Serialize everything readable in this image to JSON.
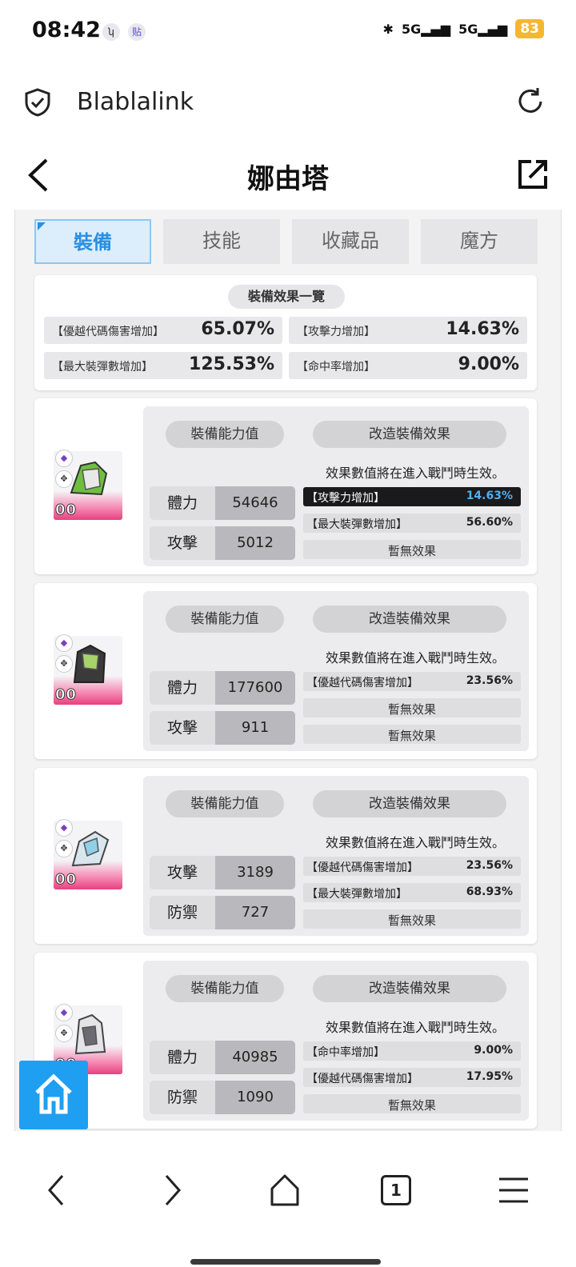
{
  "status": {
    "time": "08:42",
    "app_icon_1": "ʮ",
    "app_icon_2": "贴",
    "net1": "5G",
    "net2": "5G",
    "battery": "83"
  },
  "browser": {
    "site_name": "Blablalink"
  },
  "header": {
    "title": "娜由塔"
  },
  "tabs": [
    {
      "label": "裝備",
      "active": true
    },
    {
      "label": "技能"
    },
    {
      "label": "收藏品"
    },
    {
      "label": "魔方"
    }
  ],
  "summary": {
    "title": "裝備效果一覽",
    "items": [
      {
        "label": "【優越代碼傷害增加】",
        "value": "65.07%"
      },
      {
        "label": "【攻擊力增加】",
        "value": "14.63%"
      },
      {
        "label": "【最大裝彈數增加】",
        "value": "125.53%"
      },
      {
        "label": "【命中率增加】",
        "value": "9.00%"
      }
    ]
  },
  "equipment_common": {
    "stat_title": "裝備能力值",
    "mod_title": "改造裝備效果",
    "mod_note": "效果數值將在進入戰鬥時生效。",
    "level": "00"
  },
  "equipment": [
    {
      "stats": [
        {
          "name": "體力",
          "value": "54646"
        },
        {
          "name": "攻擊",
          "value": "5012"
        }
      ],
      "mods": [
        {
          "label": "【攻擊力增加】",
          "value": "14.63%",
          "highlight": true
        },
        {
          "label": "【最大裝彈數增加】",
          "value": "56.60%"
        },
        {
          "empty": "暫無效果"
        }
      ]
    },
    {
      "stats": [
        {
          "name": "體力",
          "value": "177600"
        },
        {
          "name": "攻擊",
          "value": "911"
        }
      ],
      "mods": [
        {
          "label": "【優越代碼傷害增加】",
          "value": "23.56%"
        },
        {
          "empty": "暫無效果"
        },
        {
          "empty": "暫無效果"
        }
      ]
    },
    {
      "stats": [
        {
          "name": "攻擊",
          "value": "3189"
        },
        {
          "name": "防禦",
          "value": "727"
        }
      ],
      "mods": [
        {
          "label": "【優越代碼傷害增加】",
          "value": "23.56%"
        },
        {
          "label": "【最大裝彈數增加】",
          "value": "68.93%"
        },
        {
          "empty": "暫無效果"
        }
      ]
    },
    {
      "stats": [
        {
          "name": "體力",
          "value": "40985"
        },
        {
          "name": "防禦",
          "value": "1090"
        }
      ],
      "mods": [
        {
          "label": "【命中率增加】",
          "value": "9.00%"
        },
        {
          "label": "【優越代碼傷害增加】",
          "value": "17.95%"
        },
        {
          "empty": "暫無效果"
        }
      ]
    }
  ],
  "bottom_nav": {
    "tab_count": "1"
  },
  "colors": {
    "accent": "#1e9ff2",
    "tab_active": "#2b8fe0",
    "highlight_value": "#4fb0f0",
    "rarity_pink": "#e8407f",
    "battery": "#f5b731"
  }
}
